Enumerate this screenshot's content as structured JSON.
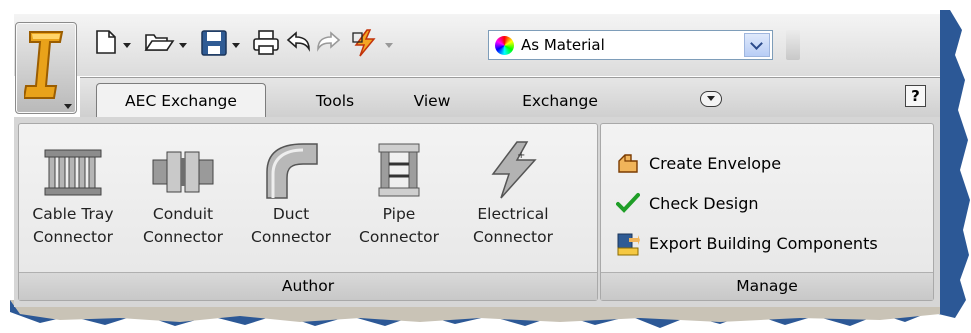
{
  "quick_access": {
    "material_combo": {
      "value": "As Material"
    },
    "icons": [
      "new-icon",
      "open-icon",
      "save-icon",
      "print-icon",
      "undo-icon",
      "redo-icon",
      "match-properties-icon"
    ]
  },
  "tabs": [
    {
      "label": "AEC Exchange",
      "active": true
    },
    {
      "label": "Tools"
    },
    {
      "label": "View"
    },
    {
      "label": "Exchange"
    }
  ],
  "help": {
    "label": "?"
  },
  "panels": {
    "author": {
      "title": "Author",
      "tools": [
        {
          "line1": "Cable Tray",
          "line2": "Connector"
        },
        {
          "line1": "Conduit",
          "line2": "Connector"
        },
        {
          "line1": "Duct",
          "line2": "Connector"
        },
        {
          "line1": "Pipe",
          "line2": "Connector"
        },
        {
          "line1": "Electrical",
          "line2": "Connector"
        }
      ]
    },
    "manage": {
      "title": "Manage",
      "tools": [
        {
          "label": "Create Envelope"
        },
        {
          "label": "Check Design"
        },
        {
          "label": "Export Building Components"
        }
      ]
    }
  },
  "colors": {
    "accent_blue": "#2f5b94",
    "check_green": "#1f9e27",
    "logo_orange": "#e9a21a"
  }
}
